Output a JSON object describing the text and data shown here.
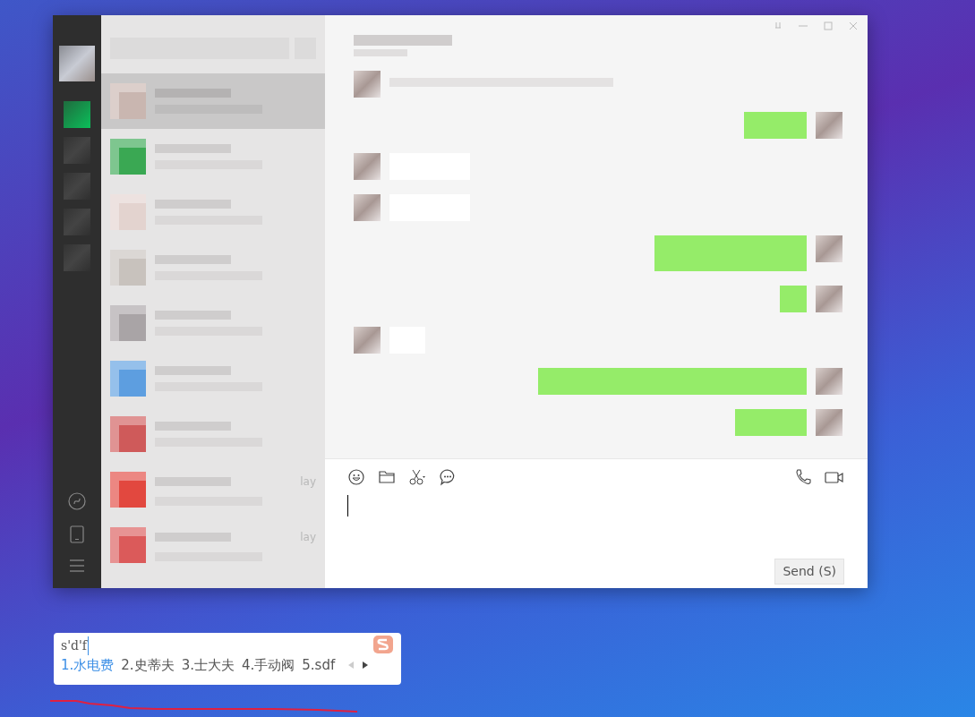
{
  "sidebar": {
    "items": [
      {
        "kind": "profile"
      },
      {
        "kind": "chats",
        "selected": true
      },
      {
        "kind": "nav",
        "selected": false
      },
      {
        "kind": "nav",
        "selected": false
      },
      {
        "kind": "nav",
        "selected": false
      },
      {
        "kind": "nav",
        "selected": false
      }
    ],
    "bottom_items": [
      {
        "kind": "mini-programs"
      },
      {
        "kind": "phone"
      },
      {
        "kind": "menu"
      }
    ]
  },
  "chat_list": [
    {
      "selected": true,
      "color": "#c9b6b0"
    },
    {
      "selected": false,
      "color": "#3aa853"
    },
    {
      "selected": false,
      "color": "#e3d3cf"
    },
    {
      "selected": false,
      "color": "#c8c2bd"
    },
    {
      "selected": false,
      "color": "#a9a4a6"
    },
    {
      "selected": false,
      "color": "#5d9ee0"
    },
    {
      "selected": false,
      "color": "#cf5a5a"
    },
    {
      "selected": false,
      "color": "#e2483f",
      "time": "lay"
    },
    {
      "selected": false,
      "color": "#db5a5a",
      "time": "lay"
    }
  ],
  "messages": [
    {
      "kind": "notice"
    },
    {
      "kind": "sent"
    },
    {
      "kind": "received"
    },
    {
      "kind": "received"
    },
    {
      "kind": "sent"
    },
    {
      "kind": "sent"
    },
    {
      "kind": "received"
    },
    {
      "kind": "sent"
    },
    {
      "kind": "sent"
    }
  ],
  "send_button": "Send (S)",
  "ime": {
    "input": "s'd'f",
    "candidates": [
      {
        "text": "1.水电费",
        "selected": true
      },
      {
        "text": "2.史蒂夫",
        "selected": false
      },
      {
        "text": "3.士大夫",
        "selected": false
      },
      {
        "text": "4.手动阀",
        "selected": false
      },
      {
        "text": "5.sdf",
        "selected": false
      }
    ],
    "prev_disabled": true,
    "next_disabled": false
  }
}
